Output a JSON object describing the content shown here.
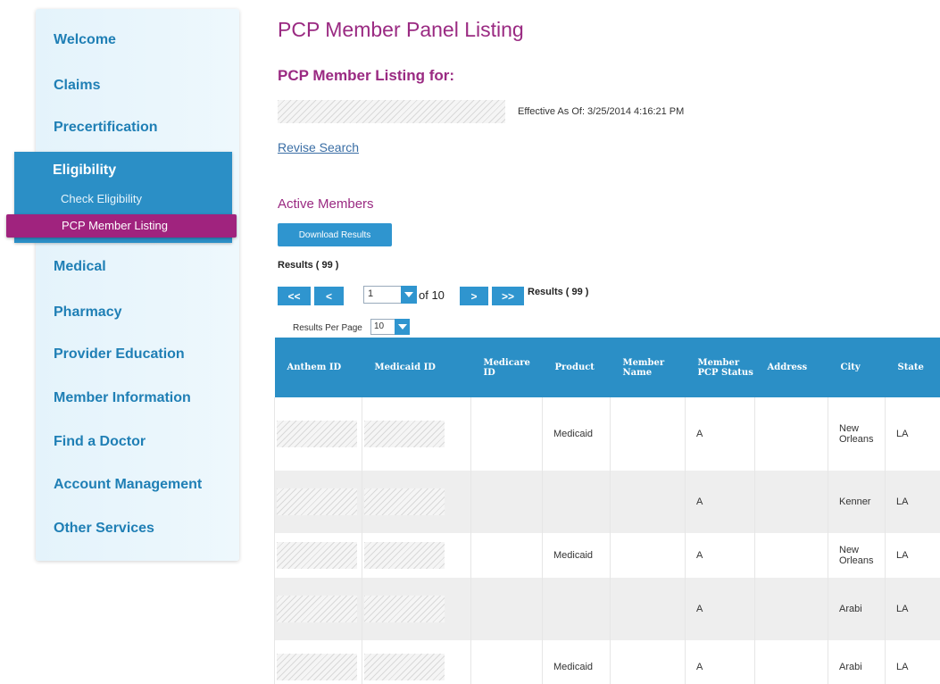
{
  "sidebar": {
    "items": [
      {
        "label": "Welcome"
      },
      {
        "label": "Claims"
      },
      {
        "label": "Precertification"
      },
      {
        "label": "Eligibility",
        "subitems": [
          {
            "label": "Check Eligibility"
          },
          {
            "label": "PCP Member Listing",
            "active": true
          }
        ]
      },
      {
        "label": "Medical"
      },
      {
        "label": "Pharmacy"
      },
      {
        "label": "Provider Education"
      },
      {
        "label": "Member Information"
      },
      {
        "label": "Find a Doctor"
      },
      {
        "label": "Account Management"
      },
      {
        "label": "Other Services"
      }
    ]
  },
  "main": {
    "title": "PCP Member Panel Listing",
    "subtitle": "PCP Member Listing for:",
    "effective": "Effective As Of: 3/25/2014 4:16:21 PM",
    "revise_link": "Revise Search",
    "section_title": "Active Members",
    "download_label": "Download Results",
    "results_label": "Results ( 99 )",
    "pagination": {
      "first": "<<",
      "prev": "<",
      "current_page": "1",
      "of_label": "of 10",
      "next": ">",
      "last": ">>",
      "results_label": "Results ( 99 )"
    },
    "results_per_page": {
      "label": "Results Per Page",
      "value": "10"
    }
  },
  "table": {
    "columns": [
      "Anthem ID",
      "Medicaid ID",
      "Medicare ID",
      "Product",
      "Member Name",
      "Member PCP Status",
      "Address",
      "City",
      "State"
    ],
    "rows": [
      {
        "product": "Medicaid",
        "status": "A",
        "city": "New Orleans",
        "state": "LA"
      },
      {
        "product": "",
        "status": "A",
        "city": "Kenner",
        "state": "LA"
      },
      {
        "product": "Medicaid",
        "status": "A",
        "city": "New Orleans",
        "state": "LA"
      },
      {
        "product": "",
        "status": "A",
        "city": "Arabi",
        "state": "LA"
      },
      {
        "product": "Medicaid",
        "status": "A",
        "city": "Arabi",
        "state": "LA"
      }
    ]
  },
  "colors": {
    "accent": "#2b8fc6",
    "brand_magenta": "#9a2a82",
    "active_nav": "#a0237e",
    "nav_text": "#1f7fb5"
  }
}
